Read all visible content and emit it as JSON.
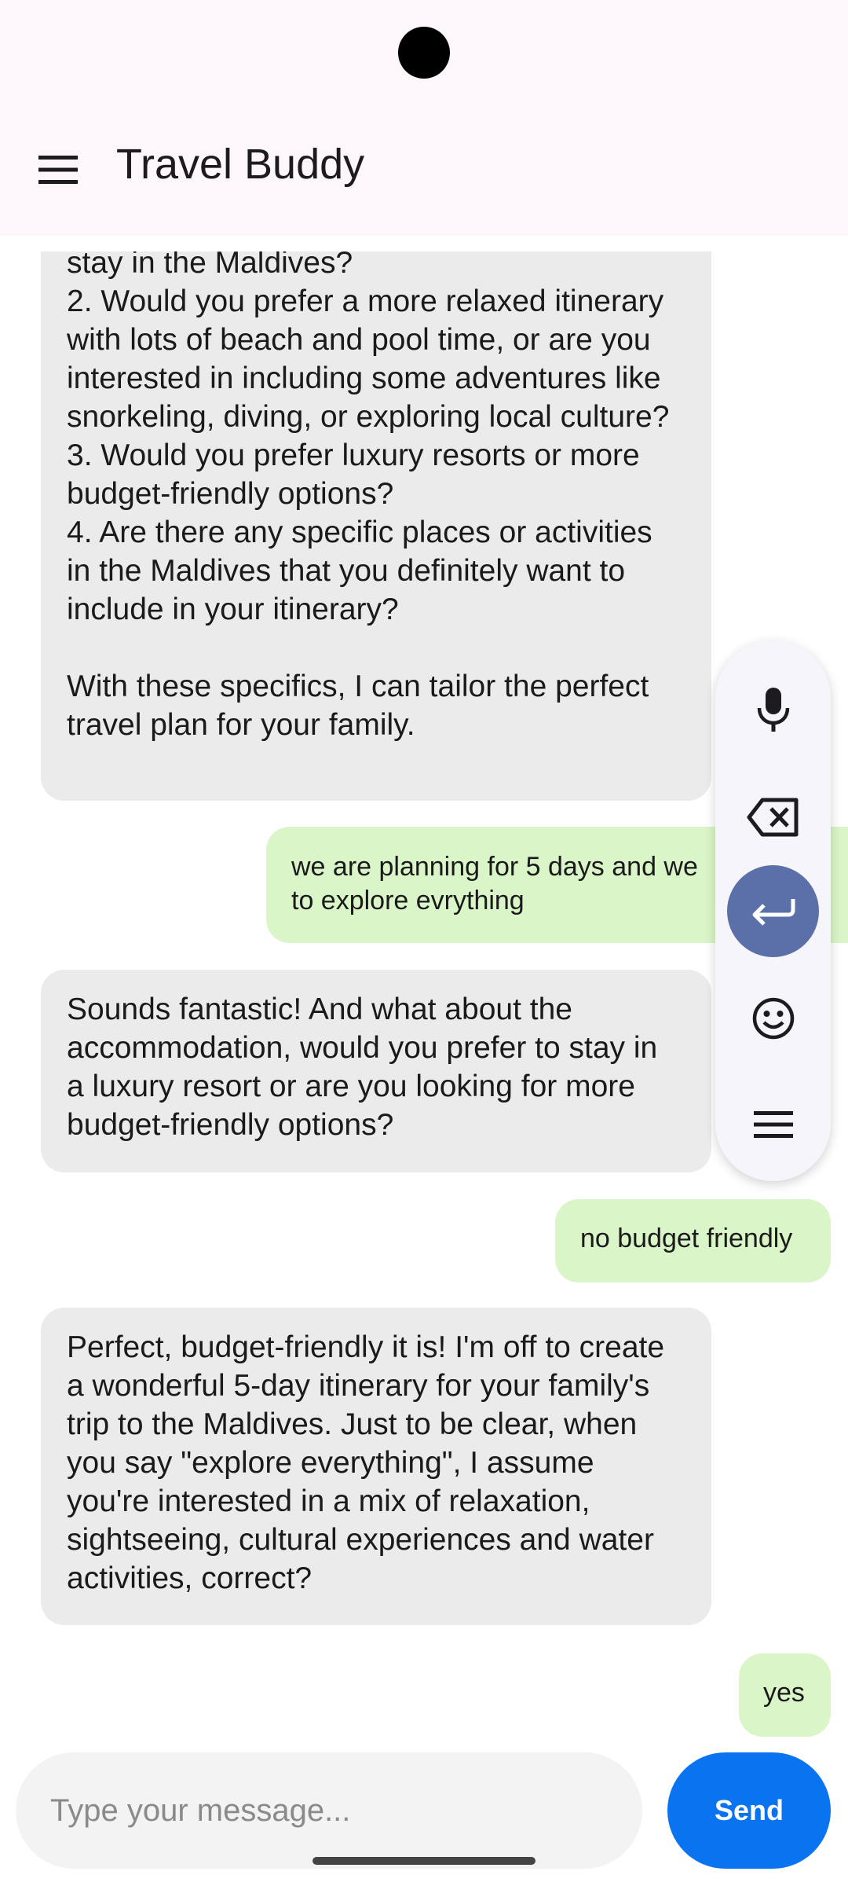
{
  "app": {
    "title": "Travel Buddy"
  },
  "icons": {
    "menu": "hamburger-menu-icon",
    "toolbar": [
      "microphone-icon",
      "backspace-icon",
      "enter-icon",
      "emoji-icon",
      "menu-lines-icon"
    ]
  },
  "colors": {
    "bot_bubble": "#ebebeb",
    "user_bubble": "#daf5c8",
    "send_button": "#0a74f0",
    "active_tool": "#5b6fa8"
  },
  "messages": [
    {
      "role": "bot",
      "text": "stay in the Maldives?\n2. Would you prefer a more relaxed itinerary with lots of beach and pool time, or are you interested in including some adventures like snorkeling, diving, or exploring local culture?\n3. Would you prefer luxury resorts or more budget-friendly options?\n4. Are there any specific places or activities in the Maldives that you definitely want to include in your itinerary?\n\nWith these specifics, I can tailor the perfect travel plan for your family."
    },
    {
      "role": "user",
      "text": "we are planning for 5 days and we\nto explore evrything"
    },
    {
      "role": "bot",
      "text": "Sounds fantastic! And what about the accommodation, would you prefer to stay in a luxury resort or are you looking for more budget-friendly options?"
    },
    {
      "role": "user",
      "text": "no budget friendly"
    },
    {
      "role": "bot",
      "text": "Perfect, budget-friendly it is! I'm off to create a wonderful 5-day itinerary for your family's trip to the Maldives. Just to be clear, when you say \"explore everything\", I assume you're interested in a mix of relaxation, sightseeing, cultural experiences and water activities, correct?"
    },
    {
      "role": "user",
      "text": "yes"
    }
  ],
  "composer": {
    "placeholder": "Type your message...",
    "value": "",
    "send_label": "Send"
  }
}
